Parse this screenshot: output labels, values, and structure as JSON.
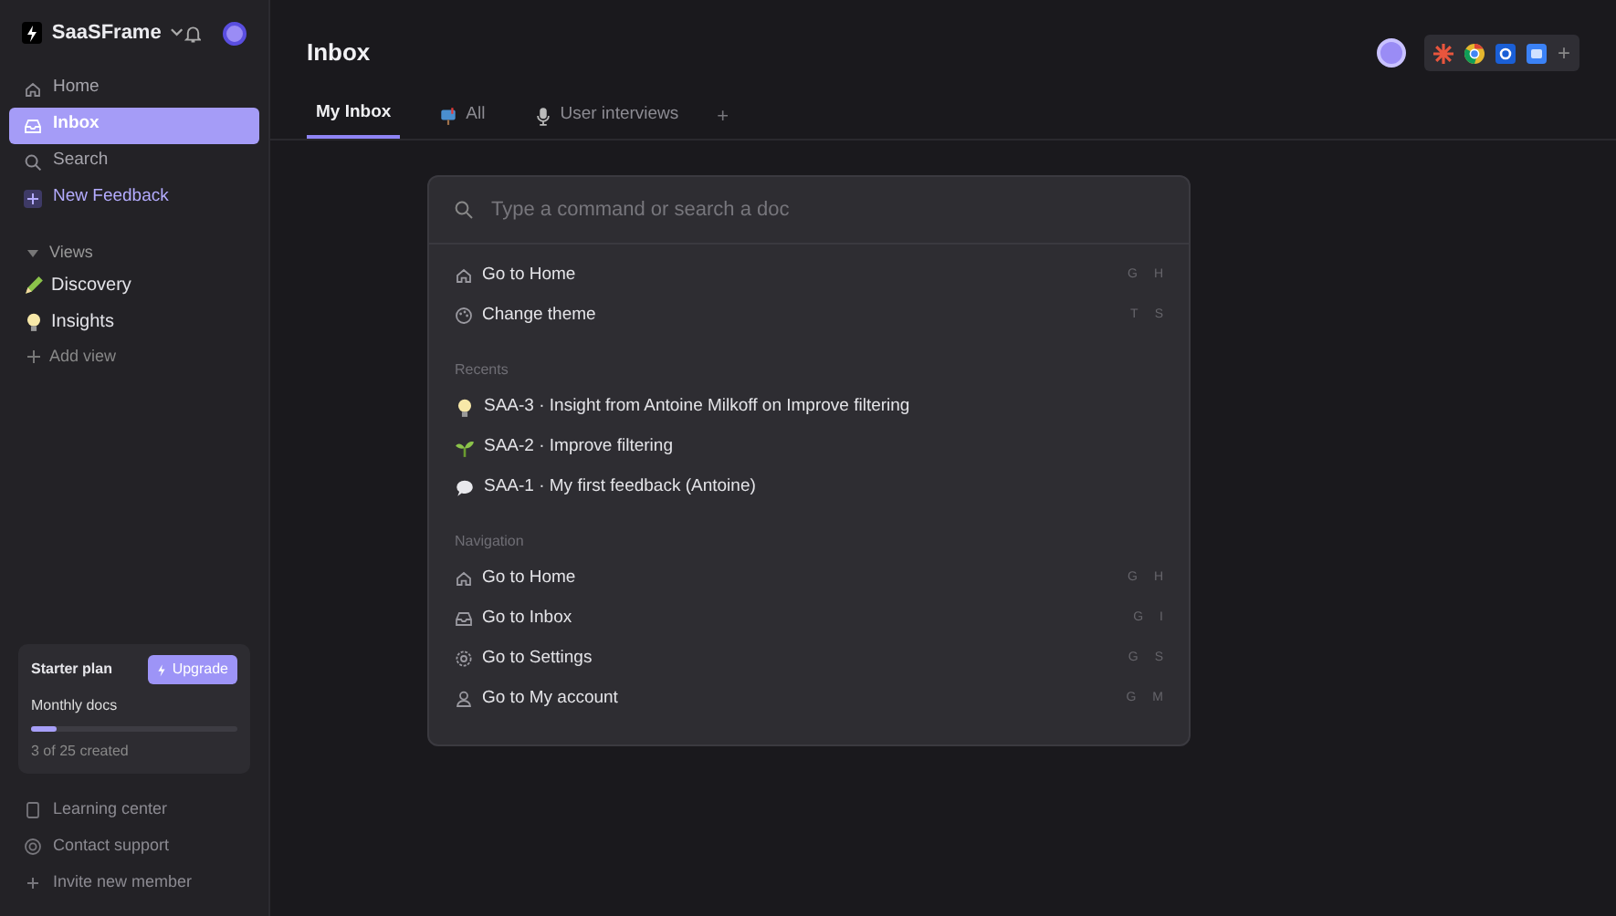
{
  "workspace": {
    "name": "SaaSFrame"
  },
  "sidebar": {
    "items": [
      {
        "label": "Home",
        "kind": "home",
        "selected": false
      },
      {
        "label": "Inbox",
        "kind": "inbox",
        "selected": true
      },
      {
        "label": "Search",
        "kind": "search",
        "selected": false
      },
      {
        "label": "New Feedback",
        "kind": "new",
        "selected": false
      }
    ],
    "views_label": "Views",
    "views": [
      {
        "label": "Discovery",
        "kind": "pencil"
      },
      {
        "label": "Insights",
        "kind": "bulb"
      }
    ],
    "add_view": "Add view",
    "plan": {
      "name": "Starter plan",
      "upgrade": "Upgrade",
      "metric": "Monthly docs",
      "level": 0.12,
      "usage": "3 of 25 created"
    },
    "footer": [
      {
        "label": "Learning center",
        "kind": "book"
      },
      {
        "label": "Contact support",
        "kind": "lifebuoy"
      },
      {
        "label": "Invite new member",
        "kind": "plus"
      }
    ]
  },
  "page": {
    "title": "Inbox"
  },
  "tabs": [
    {
      "label": "My Inbox",
      "kind": "plain",
      "selected": true
    },
    {
      "label": "All",
      "kind": "mailbox",
      "selected": false
    },
    {
      "label": "User interviews",
      "kind": "mic",
      "selected": false
    }
  ],
  "tab_add": "+",
  "toolbar": {
    "add": "+"
  },
  "palette": {
    "placeholder": "Type a command or search a doc",
    "top": [
      {
        "label": "Go to Home",
        "kind": "home",
        "keys": [
          "G",
          "H"
        ]
      },
      {
        "label": "Change theme",
        "kind": "palette",
        "keys": [
          "T",
          "S"
        ]
      }
    ],
    "sections": [
      {
        "title": "Recents",
        "items": [
          {
            "label": "SAA-3 · Insight from Antoine Milkoff on Improve filtering",
            "kind": "bulb"
          },
          {
            "label": "SAA-2 · Improve filtering",
            "kind": "sprout"
          },
          {
            "label": "SAA-1 · My first feedback (Antoine)",
            "kind": "speech"
          }
        ]
      },
      {
        "title": "Navigation",
        "items": [
          {
            "label": "Go to Home",
            "kind": "home",
            "keys": [
              "G",
              "H"
            ]
          },
          {
            "label": "Go to Inbox",
            "kind": "inbox",
            "keys": [
              "G",
              "I"
            ]
          },
          {
            "label": "Go to Settings",
            "kind": "gear",
            "keys": [
              "G",
              "S"
            ]
          },
          {
            "label": "Go to My account",
            "kind": "user",
            "keys": [
              "G",
              "M"
            ]
          }
        ]
      }
    ]
  }
}
